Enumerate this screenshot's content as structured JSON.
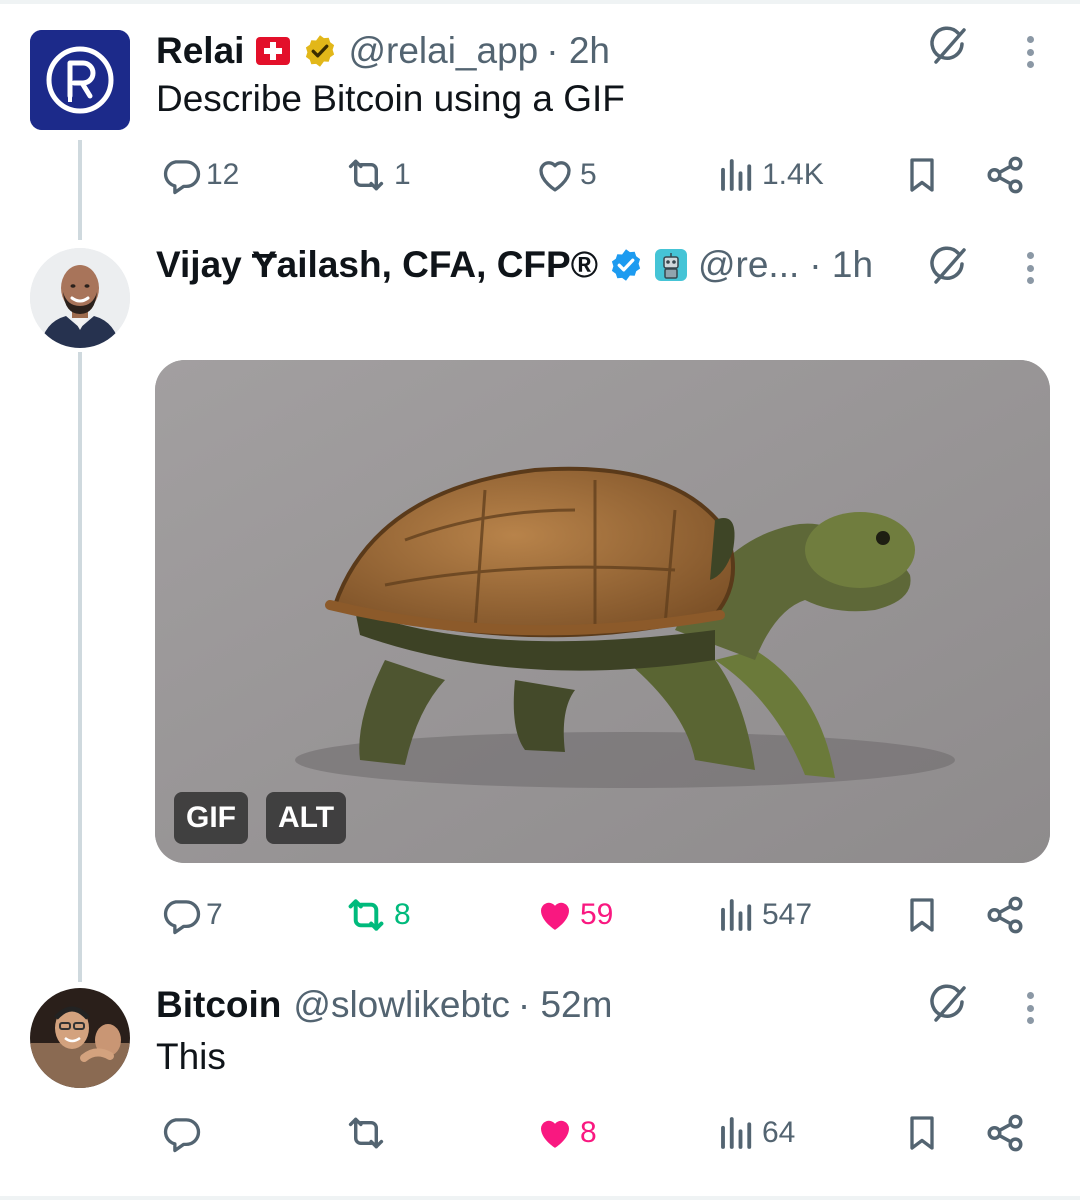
{
  "posts": [
    {
      "name": "Relai",
      "handle": "@relai_app",
      "time": "· 2h",
      "text": "Describe Bitcoin using a GIF",
      "replies": "12",
      "reposts": "1",
      "likes": "5",
      "views": "1.4K",
      "liked": false,
      "reposted": false
    },
    {
      "name": "Vijay Ɏailash, CFA, CFP®",
      "handle": "@re...",
      "time": "· 1h",
      "media_tags": {
        "gif": "GIF",
        "alt": "ALT"
      },
      "replies": "7",
      "reposts": "8",
      "likes": "59",
      "views": "547",
      "liked": true,
      "reposted": true
    },
    {
      "name": "Bitcoin",
      "handle": "@slowlikebtc",
      "time": "· 52m",
      "text": "This",
      "replies": "",
      "reposts": "",
      "likes": "8",
      "views": "64",
      "liked": true,
      "reposted": false
    }
  ],
  "colors": {
    "text": "#0f1419",
    "secondary": "#536471",
    "like": "#f91880",
    "repost": "#00ba7c",
    "verified_blue": "#1d9bf0",
    "verified_gold": "#e2b719",
    "thread_line": "#cfd9de"
  },
  "icons": [
    "relai-logo",
    "swiss-flag-icon",
    "gold-verified-icon",
    "blue-verified-icon",
    "robot-emoji-icon",
    "grok-icon",
    "more-icon",
    "reply-icon",
    "repost-icon",
    "like-icon",
    "views-icon",
    "bookmark-icon",
    "share-icon"
  ]
}
